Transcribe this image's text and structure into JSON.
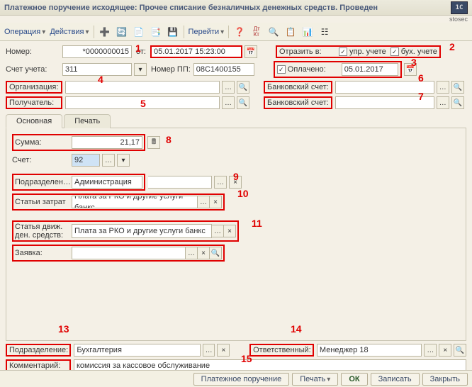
{
  "title": "Платежное поручение исходящее: Прочее списание безналичных денежных средств. Проведен",
  "brand": "stosec",
  "toolbar": {
    "operation": "Операция",
    "actions": "Действия",
    "goto": "Перейти"
  },
  "fields": {
    "number_lbl": "Номер:",
    "number_val": "*0000000015",
    "from_lbl": "от:",
    "from_val": "05.01.2017 15:23:00",
    "account_lbl": "Счет учета:",
    "account_val": "311",
    "pp_lbl": "Номер ПП:",
    "pp_val": "08С1400155",
    "org_lbl": "Организация:",
    "org_val": "",
    "recip_lbl": "Получатель:",
    "recip_val": "",
    "reflect_lbl": "Отразить в:",
    "reflect_opt1": "упр. учете",
    "reflect_opt2": "бух. учете",
    "paid_lbl": "Оплачено:",
    "paid_val": "05.01.2017",
    "bank_lbl": "Банковский счет:",
    "bank_val": "",
    "bank2_lbl": "Банковский счет:",
    "bank2_val": ""
  },
  "tabs": {
    "main": "Основная",
    "print": "Печать"
  },
  "tab_main": {
    "sum_lbl": "Сумма:",
    "sum_val": "21,17",
    "acct_lbl": "Счет:",
    "acct_val": "92",
    "dept_lbl": "Подразделен…",
    "dept_val": "Администрация",
    "cost_lbl": "Статьи затрат",
    "cost_val": "Плата за РКО и другие услуги банкс",
    "move_lbl1": "Статья движ.",
    "move_lbl2": "ден. средств:",
    "move_val": "Плата за РКО и другие услуги банкс",
    "req_lbl": "Заявка:",
    "req_val": ""
  },
  "footer": {
    "dept_lbl": "Подразделение:",
    "dept_val": "Бухгалтерия",
    "resp_lbl": "Ответственный:",
    "resp_val": "Менеджер 18",
    "comment_lbl": "Комментарий:",
    "comment_val": "комиссия за кассовое обслуживание"
  },
  "buttons": {
    "po": "Платежное поручение",
    "print": "Печать",
    "ok": "ОК",
    "save": "Записать",
    "close": "Закрыть"
  },
  "ann": {
    "n1": "1",
    "n2": "2",
    "n3": "3",
    "n4": "4",
    "n5": "5",
    "n6": "6",
    "n7": "7",
    "n8": "8",
    "n9": "9",
    "n10": "10",
    "n11": "11",
    "n13": "13",
    "n14": "14",
    "n15": "15"
  }
}
